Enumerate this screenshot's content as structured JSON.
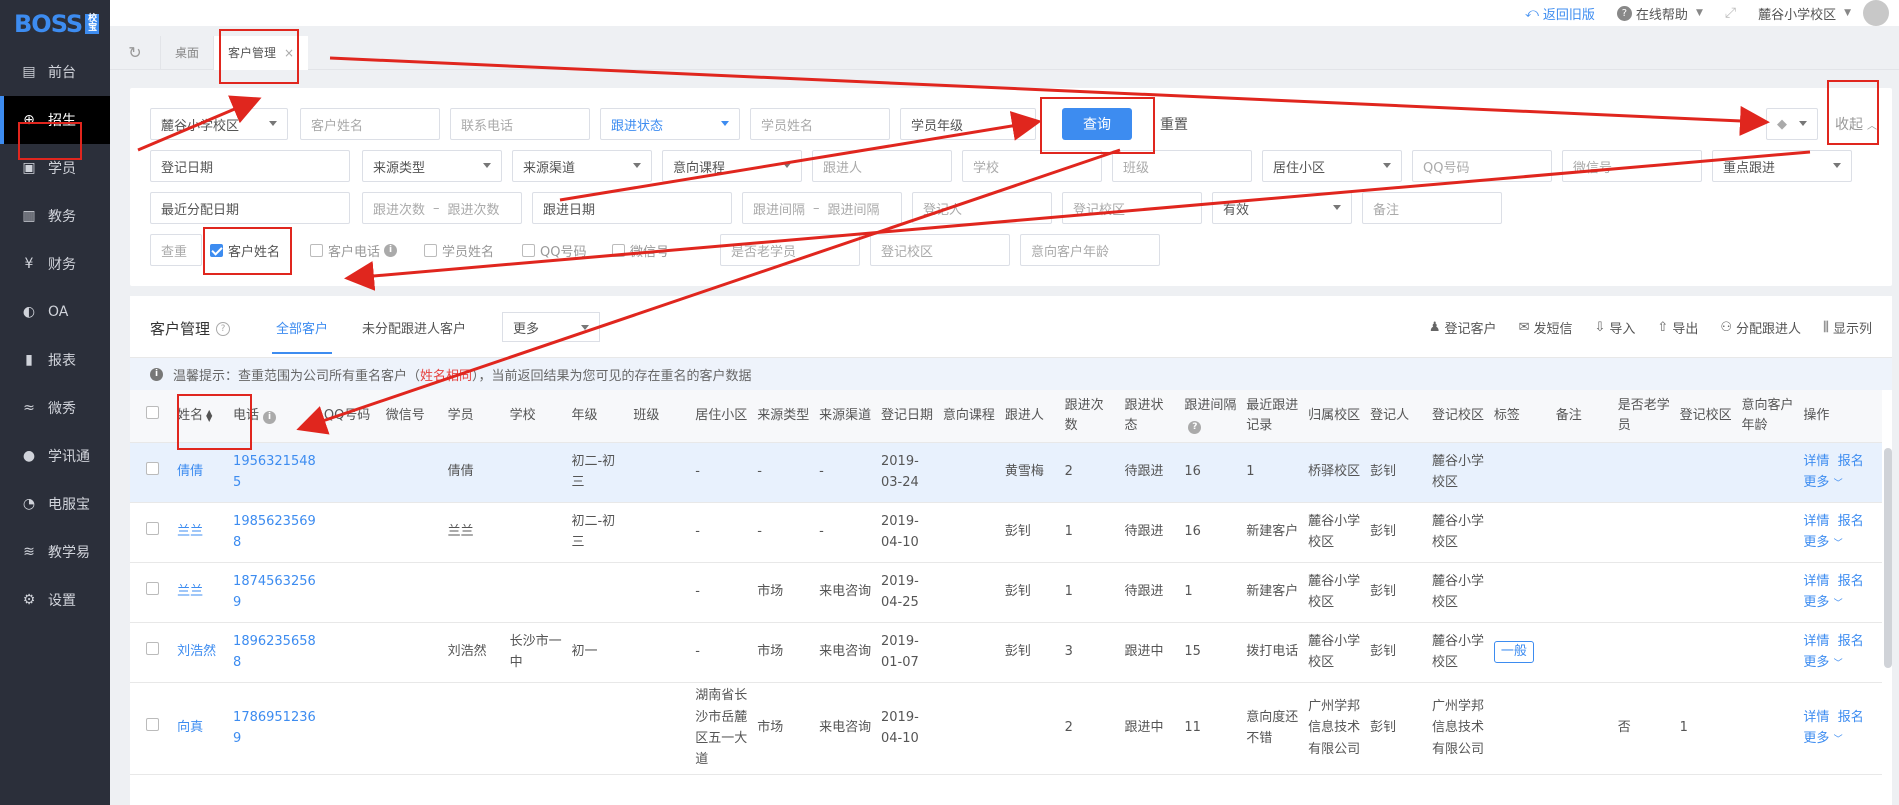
{
  "app": {
    "logo": "BOSS",
    "logo_sub": "校宝"
  },
  "sidebar": {
    "items": [
      {
        "label": "前台",
        "icon": "calendar-icon"
      },
      {
        "label": "招生",
        "icon": "user-add-icon",
        "active": true
      },
      {
        "label": "学员",
        "icon": "id-card-icon"
      },
      {
        "label": "教务",
        "icon": "book-icon"
      },
      {
        "label": "财务",
        "icon": "yen-icon"
      },
      {
        "label": "OA",
        "icon": "toggle-icon"
      },
      {
        "label": "报表",
        "icon": "bar-chart-icon"
      },
      {
        "label": "微秀",
        "icon": "wave-icon"
      },
      {
        "label": "学讯通",
        "icon": "location-icon"
      },
      {
        "label": "电服宝",
        "icon": "headset-icon"
      },
      {
        "label": "教学易",
        "icon": "teaching-icon"
      },
      {
        "label": "设置",
        "icon": "gear-icon"
      }
    ]
  },
  "topbar": {
    "back_old": "返回旧版",
    "help": "在线帮助",
    "campus": "麓谷小学校区"
  },
  "tabs": {
    "desk": "桌面",
    "customer": "客户管理"
  },
  "filter": {
    "campus": "麓谷小学校区",
    "customer_name": "客户姓名",
    "phone": "联系电话",
    "follow_status": "跟进状态",
    "student_name": "学员姓名",
    "student_grade": "学员年级",
    "query": "查询",
    "reset": "重置",
    "collapse": "收起",
    "reg_date": "登记日期",
    "source_type": "来源类型",
    "source_channel": "来源渠道",
    "intent_course": "意向课程",
    "follower": "跟进人",
    "school": "学校",
    "class": "班级",
    "community": "居住小区",
    "qq": "QQ号码",
    "wechat": "微信号",
    "key_follow": "重点跟进",
    "last_assign_date": "最近分配日期",
    "follow_count_from": "跟进次数",
    "range_sep": "–",
    "follow_count_to": "跟进次数",
    "follow_date": "跟进日期",
    "follow_interval_from": "跟进间隔",
    "follow_interval_to": "跟进间隔",
    "registrar": "登记人",
    "reg_campus": "登记校区",
    "valid": "有效",
    "remark": "备注",
    "dedup": "查重",
    "chk_customer_name": "客户姓名",
    "chk_customer_phone": "客户电话",
    "chk_student_name": "学员姓名",
    "chk_qq": "QQ号码",
    "chk_wechat": "微信号",
    "is_old_student": "是否老学员",
    "reg_campus2": "登记校区",
    "intent_age": "意向客户年龄"
  },
  "panel": {
    "title": "客户管理",
    "tab_all": "全部客户",
    "tab_unassigned": "未分配跟进人客户",
    "more": "更多",
    "actions": [
      {
        "label": "登记客户",
        "icon": "user-plus-icon"
      },
      {
        "label": "发短信",
        "icon": "message-icon"
      },
      {
        "label": "导入",
        "icon": "import-icon"
      },
      {
        "label": "导出",
        "icon": "export-icon"
      },
      {
        "label": "分配跟进人",
        "icon": "assign-icon"
      },
      {
        "label": "显示列",
        "icon": "columns-icon"
      }
    ],
    "tip_prefix": "温馨提示：查重范围为公司所有重名客户（",
    "tip_highlight": "姓名相同",
    "tip_suffix": "），当前返回结果为您可见的存在重名的客户数据"
  },
  "table": {
    "headers": [
      "姓名",
      "电话",
      "QQ号码",
      "微信号",
      "学员",
      "学校",
      "年级",
      "班级",
      "居住小区",
      "来源类型",
      "来源渠道",
      "登记日期",
      "意向课程",
      "跟进人",
      "跟进次数",
      "跟进状态",
      "跟进间隔",
      "最近跟进记录",
      "归属校区",
      "登记人",
      "登记校区",
      "标签",
      "备注",
      "是否老学员",
      "登记校区",
      "意向客户年龄",
      "操作"
    ],
    "rows": [
      {
        "name": "倩倩",
        "phone": "19563215485",
        "qq": "",
        "wechat": "",
        "student": "倩倩",
        "school": "",
        "grade": "初二-初三",
        "class": "",
        "community": "-",
        "source_type": "-",
        "source_channel": "-",
        "reg_date": "2019-03-24",
        "intent_course": "",
        "follower": "黄雪梅",
        "follow_count": "2",
        "follow_status": "待跟进",
        "follow_interval": "16",
        "last_record": "1",
        "belong_campus": "桥驿校区",
        "registrar": "彭钊",
        "reg_campus": "麓谷小学校区",
        "tag": "",
        "remark": "",
        "old_student": "",
        "reg_campus2": "",
        "intent_age": ""
      },
      {
        "name": "兰兰",
        "phone": "19856235698",
        "qq": "",
        "wechat": "",
        "student": "兰兰",
        "school": "",
        "grade": "初二-初三",
        "class": "",
        "community": "-",
        "source_type": "-",
        "source_channel": "-",
        "reg_date": "2019-04-10",
        "intent_course": "",
        "follower": "彭钊",
        "follow_count": "1",
        "follow_status": "待跟进",
        "follow_interval": "16",
        "last_record": "新建客户",
        "belong_campus": "麓谷小学校区",
        "registrar": "彭钊",
        "reg_campus": "麓谷小学校区",
        "tag": "",
        "remark": "",
        "old_student": "",
        "reg_campus2": "",
        "intent_age": ""
      },
      {
        "name": "兰兰",
        "phone": "18745632569",
        "qq": "",
        "wechat": "",
        "student": "",
        "school": "",
        "grade": "",
        "class": "",
        "community": "-",
        "source_type": "市场",
        "source_channel": "来电咨询",
        "reg_date": "2019-04-25",
        "intent_course": "",
        "follower": "彭钊",
        "follow_count": "1",
        "follow_status": "待跟进",
        "follow_interval": "1",
        "last_record": "新建客户",
        "belong_campus": "麓谷小学校区",
        "registrar": "彭钊",
        "reg_campus": "麓谷小学校区",
        "tag": "",
        "remark": "",
        "old_student": "",
        "reg_campus2": "",
        "intent_age": ""
      },
      {
        "name": "刘浩然",
        "phone": "18962356588",
        "qq": "",
        "wechat": "",
        "student": "刘浩然",
        "school": "长沙市一中",
        "grade": "初一",
        "class": "",
        "community": "-",
        "source_type": "市场",
        "source_channel": "来电咨询",
        "reg_date": "2019-01-07",
        "intent_course": "",
        "follower": "彭钊",
        "follow_count": "3",
        "follow_status": "跟进中",
        "follow_interval": "15",
        "last_record": "拨打电话",
        "belong_campus": "麓谷小学校区",
        "registrar": "彭钊",
        "reg_campus": "麓谷小学校区",
        "tag": "一般",
        "remark": "",
        "old_student": "",
        "reg_campus2": "",
        "intent_age": ""
      },
      {
        "name": "向真",
        "phone": "17869512369",
        "qq": "",
        "wechat": "",
        "student": "",
        "school": "",
        "grade": "",
        "class": "",
        "community": "湖南省长沙市岳麓区五一大道",
        "source_type": "市场",
        "source_channel": "来电咨询",
        "reg_date": "2019-04-10",
        "intent_course": "",
        "follower": "",
        "follow_count": "2",
        "follow_status": "跟进中",
        "follow_interval": "11",
        "last_record": "意向度还不错",
        "belong_campus": "广州学邦信息技术有限公司",
        "registrar": "彭钊",
        "reg_campus": "广州学邦信息技术有限公司",
        "tag": "",
        "remark": "",
        "old_student": "否",
        "reg_campus2": "1",
        "intent_age": ""
      }
    ],
    "ops": {
      "detail": "详情",
      "signup": "报名",
      "more": "更多"
    }
  },
  "colors": {
    "accent": "#3d8cf0",
    "sidebar_bg": "#2b2f3a",
    "annotation": "#e0261e"
  }
}
